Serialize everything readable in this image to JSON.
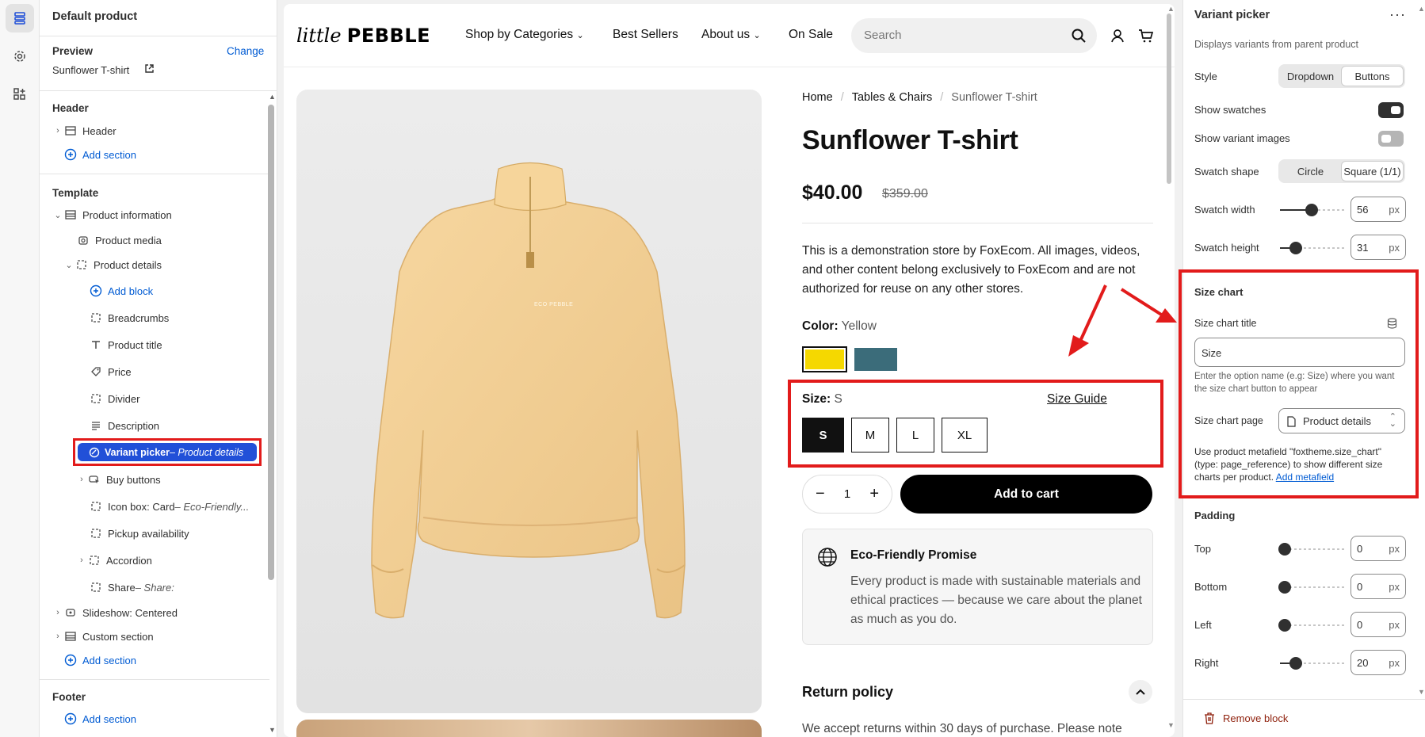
{
  "sidebar": {
    "title": "Default product",
    "preview_label": "Preview",
    "change_link": "Change",
    "preview_value": "Sunflower T-shirt",
    "header_section": "Header",
    "header_item": "Header",
    "add_section": "Add section",
    "template_section": "Template",
    "tree": {
      "product_information": "Product information",
      "product_media": "Product media",
      "product_details": "Product details",
      "add_block": "Add block",
      "breadcrumbs": "Breadcrumbs",
      "product_title": "Product title",
      "price": "Price",
      "divider": "Divider",
      "description": "Description",
      "variant_picker": "Variant picker",
      "variant_picker_sub": " – Product details",
      "buy_buttons": "Buy buttons",
      "icon_box": "Icon box: Card",
      "icon_box_sub": " – Eco-Friendly...",
      "pickup": "Pickup availability",
      "accordion": "Accordion",
      "share": "Share",
      "share_sub": " – Share:",
      "slideshow": "Slideshow: Centered",
      "custom_section": "Custom section"
    },
    "footer_section": "Footer"
  },
  "store": {
    "logo_script": "little",
    "logo_bold": "PEBBLE",
    "nav": [
      "Shop by Categories",
      "Best Sellers",
      "About us",
      "On Sale"
    ],
    "search_placeholder": "Search",
    "breadcrumbs": [
      "Home",
      "Tables & Chairs",
      "Sunflower T-shirt"
    ],
    "product_title": "Sunflower T-shirt",
    "price": "$40.00",
    "compare_price": "$359.00",
    "description": "This is a demonstration store by FoxEcom. All images, videos, and other content belong exclusively to FoxEcom and are not authorized for reuse on any other stores.",
    "color_label": "Color:",
    "color_value": "Yellow",
    "colors": [
      "#f5d800",
      "#3b6c7a"
    ],
    "size_label": "Size:",
    "size_value": "S",
    "size_guide": "Size Guide",
    "sizes": [
      "S",
      "M",
      "L",
      "XL"
    ],
    "quantity": "1",
    "add_to_cart": "Add to cart",
    "eco_title": "Eco-Friendly Promise",
    "eco_body": "Every product is made with sustainable materials and ethical practices — because we care about the planet as much as you do.",
    "return_title": "Return policy",
    "return_body": "We accept returns within 30 days of purchase. Please note",
    "shirt_print": "ECO PEBBLE"
  },
  "panel": {
    "title": "Variant picker",
    "subtitle": "Displays variants from parent product",
    "style_label": "Style",
    "style_options": [
      "Dropdown",
      "Buttons"
    ],
    "show_swatches": "Show swatches",
    "show_variant_images": "Show variant images",
    "swatch_shape": "Swatch shape",
    "shape_options": [
      "Circle",
      "Square (1/1)"
    ],
    "swatch_width": "Swatch width",
    "swatch_width_value": "56",
    "swatch_height": "Swatch height",
    "swatch_height_value": "31",
    "unit": "px",
    "size_chart_heading": "Size chart",
    "size_chart_title_label": "Size chart title",
    "size_chart_title_value": "Size",
    "size_chart_help": "Enter the option name (e.g: Size) where you want the size chart button to appear",
    "size_chart_page_label": "Size chart page",
    "size_chart_page_value": "Product details",
    "metafield_help": "Use product metafield \"foxtheme.size_chart\" (type: page_reference) to show different size charts per product.",
    "metafield_link": "Add metafield",
    "padding_heading": "Padding",
    "padding_top": "Top",
    "padding_top_value": "0",
    "padding_bottom": "Bottom",
    "padding_bottom_value": "0",
    "padding_left": "Left",
    "padding_left_value": "0",
    "padding_right": "Right",
    "padding_right_value": "20",
    "remove_block": "Remove block"
  }
}
